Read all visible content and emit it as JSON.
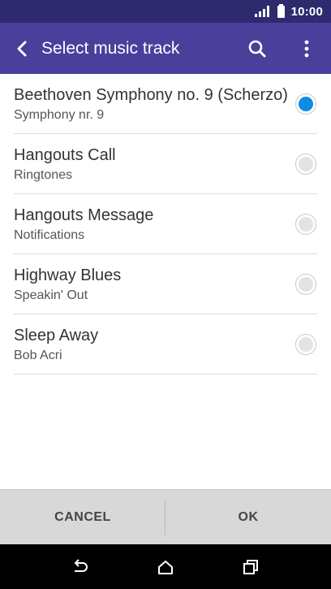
{
  "status_bar": {
    "time": "10:00"
  },
  "app_bar": {
    "title": "Select music track",
    "back_icon": "arrow-back-icon",
    "search_icon": "search-icon",
    "menu_icon": "more-vert-icon"
  },
  "tracks": [
    {
      "title": "Beethoven Symphony no. 9 (Scherzo)",
      "subtitle": "Symphony nr. 9",
      "selected": true
    },
    {
      "title": "Hangouts Call",
      "subtitle": "Ringtones",
      "selected": false
    },
    {
      "title": "Hangouts Message",
      "subtitle": "Notifications",
      "selected": false
    },
    {
      "title": "Highway Blues",
      "subtitle": "Speakin' Out",
      "selected": false
    },
    {
      "title": "Sleep Away",
      "subtitle": "Bob Acri",
      "selected": false
    }
  ],
  "buttons": {
    "cancel": "CANCEL",
    "ok": "OK"
  },
  "colors": {
    "status_bar": "#2e2a6e",
    "app_bar": "#4a3f9b",
    "radio_selected": "#0d8ce6"
  }
}
